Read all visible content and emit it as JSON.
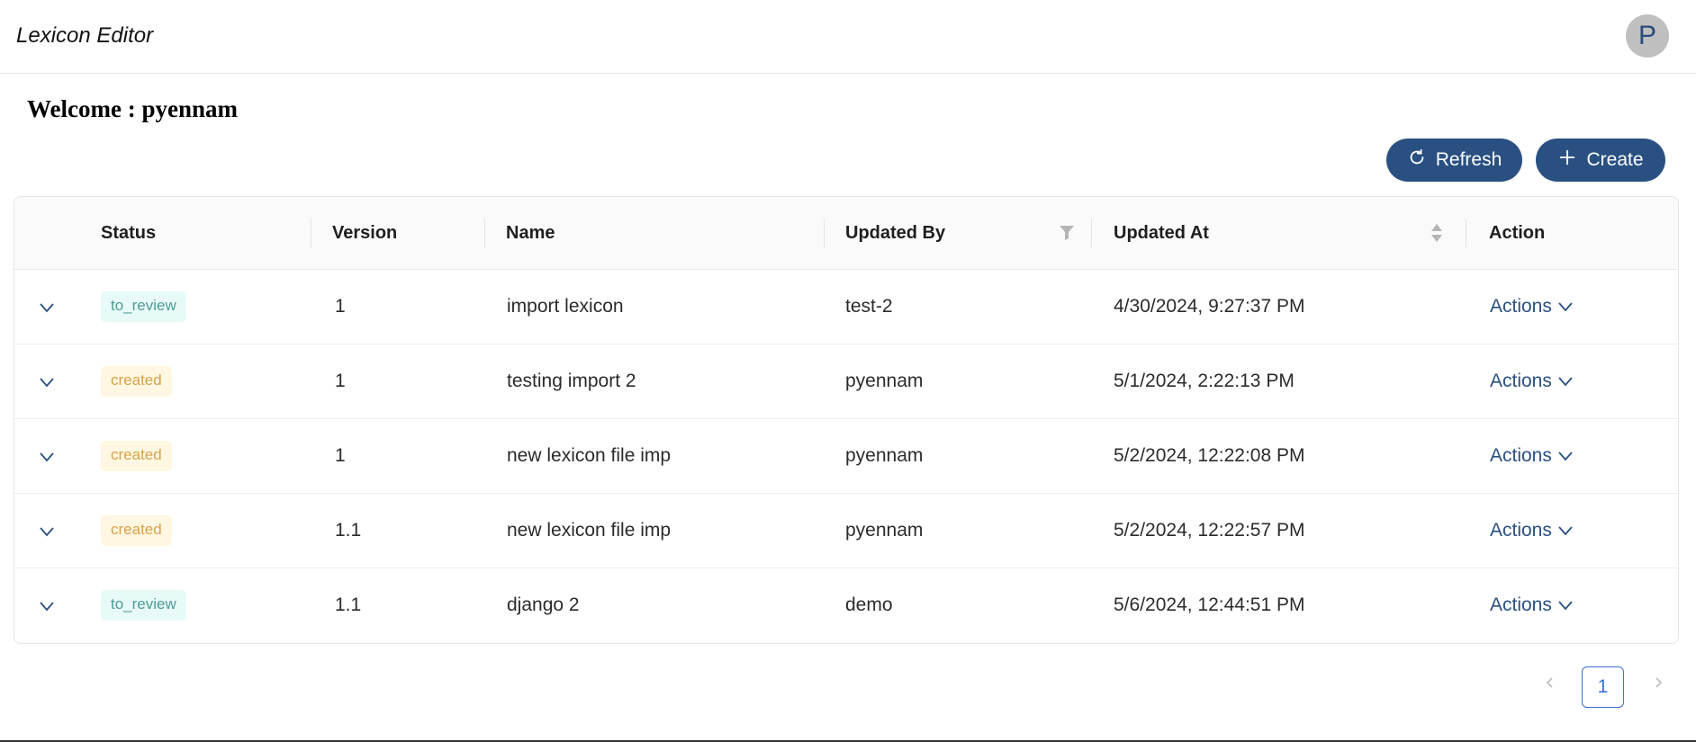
{
  "app": {
    "title": "Lexicon Editor",
    "avatar_letter": "P"
  },
  "welcome": "Welcome : pyennam",
  "toolbar": {
    "refresh_label": "Refresh",
    "create_label": "Create"
  },
  "table": {
    "columns": {
      "status": "Status",
      "version": "Version",
      "name": "Name",
      "updated_by": "Updated By",
      "updated_at": "Updated At",
      "action": "Action"
    },
    "rows": [
      {
        "status": "to_review",
        "version": "1",
        "name": "import lexicon",
        "updated_by": "test-2",
        "updated_at": "4/30/2024, 9:27:37 PM",
        "action": "Actions"
      },
      {
        "status": "created",
        "version": "1",
        "name": "testing import 2",
        "updated_by": "pyennam",
        "updated_at": "5/1/2024, 2:22:13 PM",
        "action": "Actions"
      },
      {
        "status": "created",
        "version": "1",
        "name": "new lexicon file imp",
        "updated_by": "pyennam",
        "updated_at": "5/2/2024, 12:22:08 PM",
        "action": "Actions"
      },
      {
        "status": "created",
        "version": "1.1",
        "name": "new lexicon file imp",
        "updated_by": "pyennam",
        "updated_at": "5/2/2024, 12:22:57 PM",
        "action": "Actions"
      },
      {
        "status": "to_review",
        "version": "1.1",
        "name": "django 2",
        "updated_by": "demo",
        "updated_at": "5/6/2024, 12:44:51 PM",
        "action": "Actions"
      }
    ]
  },
  "pagination": {
    "current_page": "1"
  },
  "colors": {
    "primary": "#2a5082",
    "review_bg": "#e8faf8",
    "review_text": "#4e9b95",
    "created_bg": "#fff7e1",
    "created_text": "#d6a34a",
    "page_active": "#3b6fd4"
  }
}
